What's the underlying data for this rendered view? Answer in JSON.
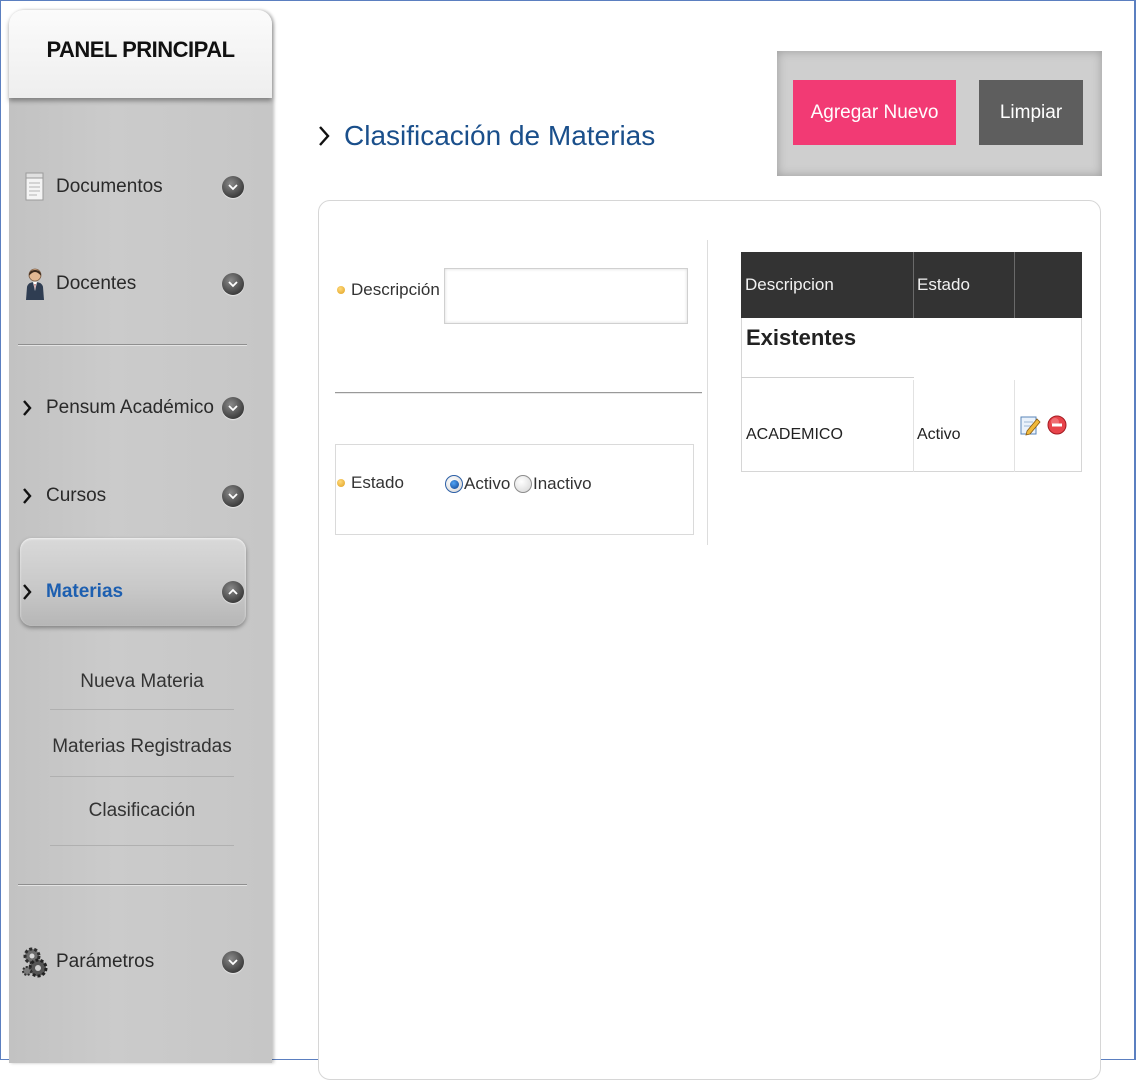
{
  "sidebar": {
    "title": "PANEL PRINCIPAL",
    "items": [
      {
        "label": "Documentos",
        "icon": "document-icon",
        "expanded": false
      },
      {
        "label": "Docentes",
        "icon": "teacher-icon",
        "expanded": false
      },
      {
        "label": "Pensum Académico",
        "icon": "chevron-right-icon",
        "expanded": false
      },
      {
        "label": "Cursos",
        "icon": "chevron-right-icon",
        "expanded": false
      },
      {
        "label": "Materias",
        "icon": "chevron-right-icon",
        "expanded": true
      },
      {
        "label": "Parámetros",
        "icon": "gears-icon",
        "expanded": false
      }
    ],
    "submenu": [
      {
        "label": "Nueva Materia"
      },
      {
        "label": "Materias Registradas"
      },
      {
        "label": "Clasificación"
      }
    ]
  },
  "main": {
    "title": "Clasificación de Materias",
    "buttons": {
      "add": "Agregar Nuevo",
      "clear": "Limpiar"
    },
    "form": {
      "descripcion_label": "Descripción",
      "descripcion_value": "",
      "estado_label": "Estado",
      "estado_options": [
        "Activo",
        "Inactivo"
      ],
      "estado_selected": "Activo"
    },
    "table": {
      "columns": [
        "Descripcion",
        "Estado",
        ""
      ],
      "caption": "Existentes",
      "rows": [
        {
          "descripcion": "ACADEMICO",
          "estado": "Activo"
        }
      ]
    }
  },
  "colors": {
    "accent_pink": "#f23a74",
    "button_gray": "#5e5e5e",
    "title_blue": "#1a4f8b",
    "active_link_blue": "#1d5fb0",
    "table_header": "#333333"
  }
}
